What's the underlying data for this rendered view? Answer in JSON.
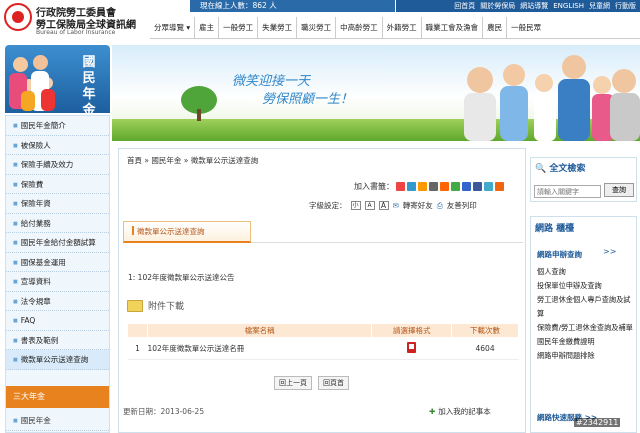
{
  "top": {
    "online": "現在線上人數：862 人",
    "links": [
      "回首頁",
      "關於勞保局",
      "網站導覽",
      "ENGLISH",
      "兒童網",
      "行動版"
    ]
  },
  "logo": {
    "line1": "行政院勞工委員會",
    "line2": "勞工保險局全球資訊網",
    "line3": "Bureau of Labor Insurance"
  },
  "nav": [
    "分眾導覽 ▾",
    "雇主",
    "一般勞工",
    "失業勞工",
    "職災勞工",
    "中高齡勞工",
    "外籍勞工",
    "職業工會及漁會",
    "農民",
    "一般民眾"
  ],
  "left_banner": {
    "title": "國民年金"
  },
  "hero": {
    "line1": "微笑迎接一天",
    "line2": "勞保照顧一生！"
  },
  "left_menu": [
    "國民年金簡介",
    "被保險人",
    "保險手續及效力",
    "保險費",
    "保險年資",
    "給付業務",
    "國民年金給付金額試算",
    "國保基金運用",
    "宣導資料",
    "法令規章",
    "FAQ",
    "書表及範例",
    "徵款單公示送達查詢"
  ],
  "left_section": {
    "title": "三大年金",
    "item": "國民年金"
  },
  "main": {
    "breadcrumb": "首頁 » 國民年金 » 徵款單公示送達查詢",
    "share_label": "加入書籤：",
    "font_label": "字級設定：",
    "font_sizes": [
      "小",
      "A",
      "A"
    ],
    "forward": "轉寄好友",
    "print": "友善列印",
    "tab": "徵款單公示送達查詢",
    "item": "1: 102年度徵款單公示送達公告",
    "attach_label": "附件下載",
    "table": {
      "headers": [
        "檔案名稱",
        "請選擇格式",
        "下載次數"
      ],
      "rows": [
        {
          "no": "1",
          "name": "102年度徵款單公示送達名冊",
          "count": "4604"
        }
      ]
    },
    "pager": [
      "回上一頁",
      "回頁首"
    ],
    "updated": "更新日期：2013-06-25",
    "memo": "加入我的記事本"
  },
  "right_search": {
    "title": "全文檢索",
    "placeholder": "請輸入關鍵字",
    "button": "查詢"
  },
  "right_links": {
    "title": "網路 櫃檯",
    "subtitle": "網路申辦查詢",
    "more": ">>",
    "items": [
      "個人查詢",
      "投保單位申辦及查詢",
      "勞工退休金個人專戶查詢及試算",
      "保險費/勞工退休金查詢及補單",
      "國民年金繳費證明",
      "網路申辦問題排除"
    ],
    "bottom": "網路快速服務 >>"
  },
  "watermark": "#2342911",
  "colors": {
    "primary": "#1f5a99",
    "accent": "#e8821e",
    "light": "#f0f7fc"
  }
}
